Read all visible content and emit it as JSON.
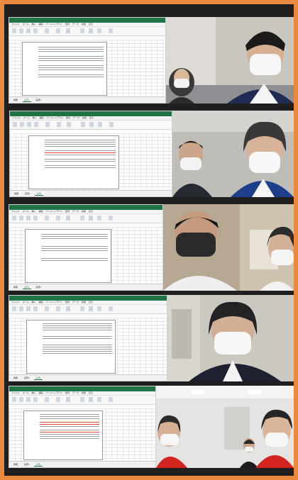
{
  "meeting": {
    "tiles": [
      {
        "excel": {
          "title": "",
          "ribbon_tabs": [
            "ファイル",
            "ホーム",
            "挿入",
            "描画",
            "ページレイアウト",
            "数式",
            "データ",
            "校閲",
            "表示"
          ],
          "formula": "",
          "sheets": [
            "講義",
            "実習1",
            "実習2"
          ],
          "active_sheet": 1
        },
        "video": {
          "participant_label": "",
          "people": 2
        }
      },
      {
        "excel": {
          "title": "",
          "ribbon_tabs": [
            "ファイル",
            "ホーム",
            "挿入",
            "描画",
            "ページレイアウト",
            "数式",
            "データ",
            "校閲",
            "表示"
          ],
          "formula": "",
          "sheets": [
            "講義",
            "実習1",
            "実習2"
          ],
          "active_sheet": 2
        },
        "video": {
          "participant_label": "",
          "people": 2
        }
      },
      {
        "excel": {
          "title": "",
          "ribbon_tabs": [
            "ファイル",
            "ホーム",
            "挿入",
            "描画",
            "ページレイアウト",
            "数式",
            "データ",
            "校閲",
            "表示"
          ],
          "formula": "",
          "sheets": [
            "講義",
            "実習1",
            "実習2"
          ],
          "active_sheet": 1
        },
        "video": {
          "participant_label": "",
          "people": 2
        }
      },
      {
        "excel": {
          "title": "",
          "ribbon_tabs": [
            "ファイル",
            "ホーム",
            "挿入",
            "描画",
            "ページレイアウト",
            "数式",
            "データ",
            "校閲",
            "表示"
          ],
          "formula": "",
          "sheets": [
            "講義",
            "実習1",
            "実習2"
          ],
          "active_sheet": 2
        },
        "video": {
          "participant_label": "",
          "people": 1
        }
      },
      {
        "excel": {
          "title": "",
          "ribbon_tabs": [
            "ファイル",
            "ホーム",
            "挿入",
            "描画",
            "ページレイアウト",
            "数式",
            "データ",
            "校閲",
            "表示"
          ],
          "formula": "",
          "sheets": [
            "講義",
            "実習1",
            "実習2"
          ],
          "active_sheet": 2
        },
        "video": {
          "participant_label": "",
          "people": 3
        }
      }
    ]
  },
  "colors": {
    "border": "#e98a3e",
    "excel_green": "#217346",
    "mask": "#f2f2f2",
    "red_uniform": "#d2231f"
  }
}
